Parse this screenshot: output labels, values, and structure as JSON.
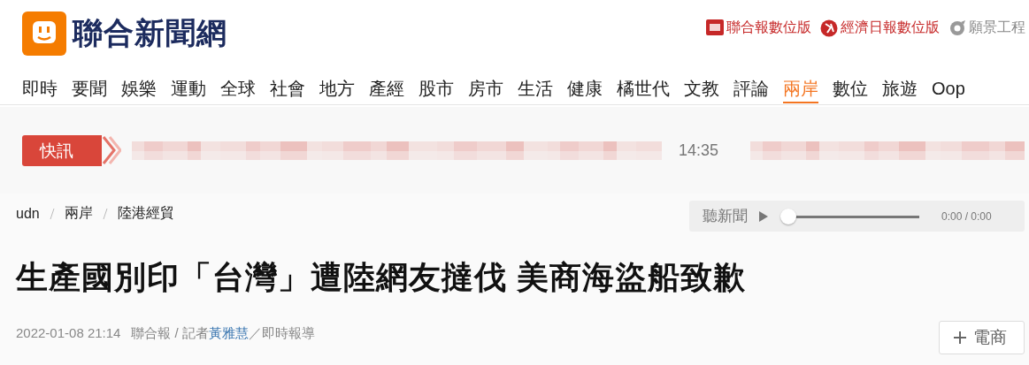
{
  "header": {
    "site_title": "聯合新聞網",
    "partner_links": [
      {
        "label": "聯合報數位版",
        "kind": "udn"
      },
      {
        "label": "經濟日報數位版",
        "kind": "money"
      },
      {
        "label": "願景工程",
        "kind": "vision"
      }
    ]
  },
  "nav": [
    {
      "label": "即時",
      "selected": false
    },
    {
      "label": "要聞",
      "selected": false
    },
    {
      "label": "娛樂",
      "selected": false
    },
    {
      "label": "運動",
      "selected": false
    },
    {
      "label": "全球",
      "selected": false
    },
    {
      "label": "社會",
      "selected": false
    },
    {
      "label": "地方",
      "selected": false
    },
    {
      "label": "產經",
      "selected": false
    },
    {
      "label": "股市",
      "selected": false
    },
    {
      "label": "房市",
      "selected": false
    },
    {
      "label": "生活",
      "selected": false
    },
    {
      "label": "健康",
      "selected": false
    },
    {
      "label": "橘世代",
      "selected": false
    },
    {
      "label": "文教",
      "selected": false
    },
    {
      "label": "評論",
      "selected": false
    },
    {
      "label": "兩岸",
      "selected": true
    },
    {
      "label": "數位",
      "selected": false
    },
    {
      "label": "旅遊",
      "selected": false
    },
    {
      "label": "Oop",
      "selected": false
    }
  ],
  "ticker": {
    "badge": "快訊",
    "time": "14:35"
  },
  "breadcrumb": [
    "udn",
    "兩岸",
    "陸港經貿"
  ],
  "audio_player": {
    "label": "聽新聞",
    "time": "0:00 / 0:00",
    "level": 0
  },
  "headline": "生產國別印「台灣」遭陸網友撻伐 美商海盜船致歉",
  "meta": {
    "datetime": "2022-01-08 21:14",
    "byline": "聯合報 / 記者",
    "reporter": "黃雅慧",
    "suffix": "／即時報導"
  },
  "follow_button": {
    "label": "電商"
  }
}
